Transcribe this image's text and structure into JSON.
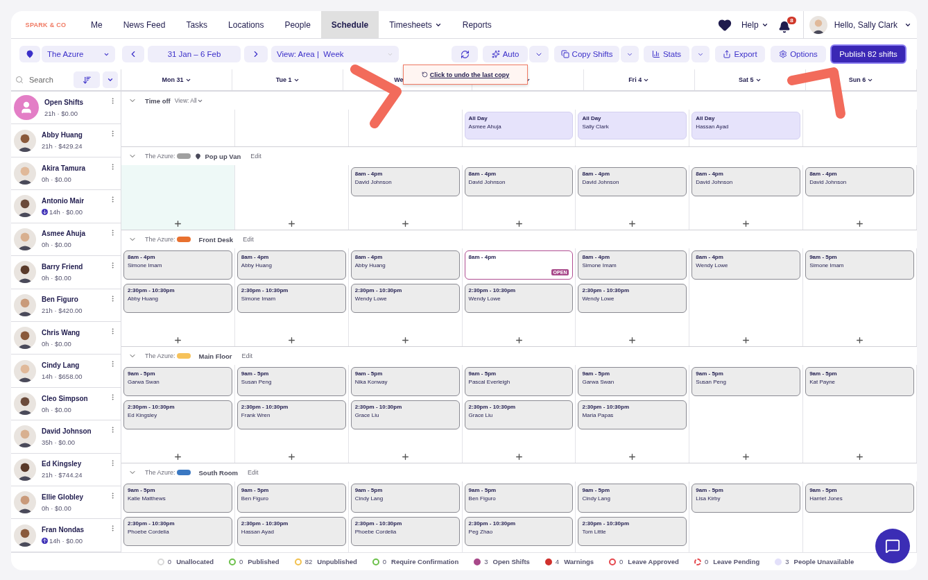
{
  "brand": "SPARK & CO",
  "nav": [
    {
      "label": "Me",
      "selected": false,
      "caret": false
    },
    {
      "label": "News Feed",
      "selected": false,
      "caret": false
    },
    {
      "label": "Tasks",
      "selected": false,
      "caret": false
    },
    {
      "label": "Locations",
      "selected": false,
      "caret": false
    },
    {
      "label": "People",
      "selected": false,
      "caret": false
    },
    {
      "label": "Schedule",
      "selected": true,
      "caret": false
    },
    {
      "label": "Timesheets",
      "selected": false,
      "caret": true
    },
    {
      "label": "Reports",
      "selected": false,
      "caret": false
    }
  ],
  "help": "Help",
  "notifications": "8",
  "greeting": "Hello, Sally Clark",
  "toolbar": {
    "location": "The Azure",
    "date_range": "31 Jan – 6 Feb",
    "view": "View: Area |  Week",
    "auto": "Auto",
    "copy": "Copy Shifts",
    "stats": "Stats",
    "export": "Export",
    "options": "Options",
    "publish": "Publish 82 shifts"
  },
  "tooltip": "Click to undo the last copy",
  "search": {
    "placeholder": "Search"
  },
  "days": [
    {
      "label": "Mon 31",
      "caret": true
    },
    {
      "label": "Tue 1",
      "caret": true
    },
    {
      "label": "We",
      "caret": false
    },
    {
      "caret": true
    },
    {
      "label": "Fri 4",
      "caret": true
    },
    {
      "label": "Sat 5",
      "caret": true
    },
    {
      "label": "Sun 6",
      "caret": true
    }
  ],
  "people": [
    {
      "name": "Open Shifts",
      "summary": "21h · $0.00",
      "kind": "open"
    },
    {
      "name": "Abby Huang",
      "summary": "21h · $429.24",
      "kind": "person"
    },
    {
      "name": "Akira Tamura",
      "summary": "0h · $0.00",
      "kind": "person"
    },
    {
      "name": "Antonio Mair",
      "summary": "14h · $0.00",
      "kind": "down"
    },
    {
      "name": "Asmee Ahuja",
      "summary": "0h · $0.00",
      "kind": "person"
    },
    {
      "name": "Barry Friend",
      "summary": "0h · $0.00",
      "kind": "person"
    },
    {
      "name": "Ben Figuro",
      "summary": "21h · $420.00",
      "kind": "person"
    },
    {
      "name": "Chris Wang",
      "summary": "0h · $0.00",
      "kind": "person"
    },
    {
      "name": "Cindy Lang",
      "summary": "14h · $658.00",
      "kind": "person"
    },
    {
      "name": "Cleo Simpson",
      "summary": "0h · $0.00",
      "kind": "person"
    },
    {
      "name": "David Johnson",
      "summary": "35h · $0.00",
      "kind": "person"
    },
    {
      "name": "Ed Kingsley",
      "summary": "21h · $744.24",
      "kind": "person"
    },
    {
      "name": "Ellie Globley",
      "summary": "0h · $0.00",
      "kind": "person"
    },
    {
      "name": "Fran Nondas",
      "summary": "14h · $0.00",
      "kind": "up"
    }
  ],
  "time_off": {
    "title": "Time off",
    "view": "View: All",
    "expanded": true,
    "cells": [
      [],
      [],
      [],
      [
        {
          "label": "All Day",
          "name": "Asmee Ahuja"
        }
      ],
      [
        {
          "label": "All Day",
          "name": "Sally Clark"
        }
      ],
      [
        {
          "label": "All Day",
          "name": "Hassan Ayad"
        }
      ],
      []
    ]
  },
  "areas": [
    {
      "prefix": "The Azure:",
      "color": "#a0a0a0",
      "name": "Pop up Van",
      "pin": true,
      "edit": "Edit",
      "expanded": true,
      "add": true,
      "cells": [
        {
          "highlighted": true
        },
        {
          "highlighted": false
        },
        {
          "highlighted": false,
          "shifts": [
            {
              "time": "8am - 4pm",
              "name": "David Johnson",
              "open": false
            }
          ]
        },
        {
          "highlighted": false,
          "shifts": [
            {
              "time": "8am - 4pm",
              "name": "David Johnson",
              "open": false
            }
          ]
        },
        {
          "highlighted": false,
          "shifts": [
            {
              "time": "8am - 4pm",
              "name": "David Johnson",
              "open": false
            }
          ]
        },
        {
          "highlighted": false,
          "shifts": [
            {
              "time": "8am - 4pm",
              "name": "David Johnson",
              "open": false
            }
          ]
        },
        {
          "highlighted": false,
          "shifts": [
            {
              "time": "8am - 4pm",
              "name": "David Johnson",
              "open": false
            }
          ]
        }
      ]
    },
    {
      "prefix": "The Azure:",
      "color": "#e8712f",
      "name": "Front Desk",
      "pin": false,
      "edit": "Edit",
      "expanded": true,
      "add": true,
      "cells": [
        {
          "highlighted": false,
          "shifts": [
            {
              "time": "8am - 4pm",
              "name": "Simone Imam",
              "open": false
            },
            {
              "time": "2:30pm - 10:30pm",
              "name": "Abby Huang",
              "open": false
            }
          ]
        },
        {
          "highlighted": false,
          "shifts": [
            {
              "time": "8am - 4pm",
              "name": "Abby Huang",
              "open": false
            },
            {
              "time": "2:30pm - 10:30pm",
              "name": "Simone Imam",
              "open": false
            }
          ]
        },
        {
          "highlighted": false,
          "shifts": [
            {
              "time": "8am - 4pm",
              "name": "Abby Huang",
              "open": false
            },
            {
              "time": "2:30pm - 10:30pm",
              "name": "Wendy Lowe",
              "open": false
            }
          ]
        },
        {
          "highlighted": false,
          "shifts": [
            {
              "time": "8am - 4pm",
              "badge": "OPEN",
              "open": true
            },
            {
              "time": "2:30pm - 10:30pm",
              "name": "Wendy Lowe",
              "open": false
            }
          ]
        },
        {
          "highlighted": false,
          "shifts": [
            {
              "time": "8am - 4pm",
              "name": "Simone Imam",
              "open": false
            },
            {
              "time": "2:30pm - 10:30pm",
              "name": "Wendy Lowe",
              "open": false
            }
          ]
        },
        {
          "highlighted": false,
          "shifts": [
            {
              "time": "8am - 4pm",
              "name": "Wendy Lowe",
              "open": false
            }
          ]
        },
        {
          "highlighted": false,
          "shifts": [
            {
              "time": "9am - 5pm",
              "name": "Simone Imam",
              "open": false
            }
          ]
        }
      ]
    },
    {
      "prefix": "The Azure:",
      "color": "#f6c25a",
      "name": "Main Floor",
      "pin": false,
      "edit": "Edit",
      "expanded": true,
      "add": true,
      "cells": [
        {
          "highlighted": false,
          "shifts": [
            {
              "time": "9am - 5pm",
              "name": "Garwa Swan",
              "open": false
            },
            {
              "time": "2:30pm - 10:30pm",
              "name": "Ed Kingsley",
              "open": false
            }
          ]
        },
        {
          "highlighted": false,
          "shifts": [
            {
              "time": "9am - 5pm",
              "name": "Susan Peng",
              "open": false
            },
            {
              "time": "2:30pm - 10:30pm",
              "name": "Frank Wren",
              "open": false
            }
          ]
        },
        {
          "highlighted": false,
          "shifts": [
            {
              "time": "9am - 5pm",
              "name": "Nika Konway",
              "open": false
            },
            {
              "time": "2:30pm - 10:30pm",
              "name": "Grace Liu",
              "open": false
            }
          ]
        },
        {
          "highlighted": false,
          "shifts": [
            {
              "time": "9am - 5pm",
              "name": "Pascal Everleigh",
              "open": false
            },
            {
              "time": "2:30pm - 10:30pm",
              "name": "Grace Liu",
              "open": false
            }
          ]
        },
        {
          "highlighted": false,
          "shifts": [
            {
              "time": "9am - 5pm",
              "name": "Garwa Swan",
              "open": false
            },
            {
              "time": "2:30pm - 10:30pm",
              "name": "Maria Papas",
              "open": false
            }
          ]
        },
        {
          "highlighted": false,
          "shifts": [
            {
              "time": "9am - 5pm",
              "name": "Susan Peng",
              "open": false
            }
          ]
        },
        {
          "highlighted": false,
          "shifts": [
            {
              "time": "9am - 5pm",
              "name": "Kat Payne",
              "open": false
            }
          ]
        }
      ]
    },
    {
      "prefix": "The Azure:",
      "color": "#3a78c2",
      "name": "South Room",
      "pin": false,
      "edit": "Edit",
      "expanded": true,
      "add": false,
      "cells": [
        {
          "highlighted": false,
          "shifts": [
            {
              "time": "9am - 5pm",
              "name": "Katie Matthews",
              "open": false
            },
            {
              "time": "2:30pm - 10:30pm",
              "name": "Phoebe Cordelia",
              "open": false
            }
          ]
        },
        {
          "highlighted": false,
          "shifts": [
            {
              "time": "9am - 5pm",
              "name": "Ben Figuro",
              "open": false
            },
            {
              "time": "2:30pm - 10:30pm",
              "name": "Hassan Ayad",
              "open": false
            }
          ]
        },
        {
          "highlighted": false,
          "shifts": [
            {
              "time": "9am - 5pm",
              "name": "Cindy Lang",
              "open": false
            },
            {
              "time": "2:30pm - 10:30pm",
              "name": "Phoebe Cordelia",
              "open": false
            }
          ]
        },
        {
          "highlighted": false,
          "shifts": [
            {
              "time": "9am - 5pm",
              "name": "Ben Figuro",
              "open": false
            },
            {
              "time": "2:30pm - 10:30pm",
              "name": "Peg Zhao",
              "open": false
            }
          ]
        },
        {
          "highlighted": false,
          "shifts": [
            {
              "time": "9am - 5pm",
              "name": "Cindy Lang",
              "open": false
            },
            {
              "time": "2:30pm - 10:30pm",
              "name": "Tom Little",
              "open": false
            }
          ]
        },
        {
          "highlighted": false,
          "shifts": [
            {
              "time": "9am - 5pm",
              "name": "Lisa Kirby",
              "open": false
            }
          ]
        },
        {
          "highlighted": false,
          "shifts": [
            {
              "time": "9am - 5pm",
              "name": "Harriet Jones",
              "open": false
            }
          ]
        }
      ]
    }
  ],
  "legend": [
    {
      "count": "0",
      "label": "Unallocated",
      "color": "#d8d8d8",
      "kind": "outline"
    },
    {
      "count": "0",
      "label": "Published",
      "color": "#6cc04a",
      "kind": "outline"
    },
    {
      "count": "82",
      "label": "Unpublished",
      "color": "#f2c14e",
      "kind": "outline"
    },
    {
      "count": "0",
      "label": "Require Confirmation",
      "color": "#6cc04a",
      "kind": "outline"
    },
    {
      "count": "3",
      "label": "Open Shifts",
      "color": "#a8498a",
      "kind": "filled"
    },
    {
      "count": "4",
      "label": "Warnings",
      "color": "#d0312d",
      "kind": "filled"
    },
    {
      "count": "0",
      "label": "Leave Approved",
      "color": "#e5484d",
      "kind": "outline"
    },
    {
      "count": "0",
      "label": "Leave Pending",
      "color": "#e5484d",
      "kind": "dashed"
    },
    {
      "count": "3",
      "label": "People Unavailable",
      "color": "#e3e0fa",
      "kind": "filled"
    }
  ]
}
